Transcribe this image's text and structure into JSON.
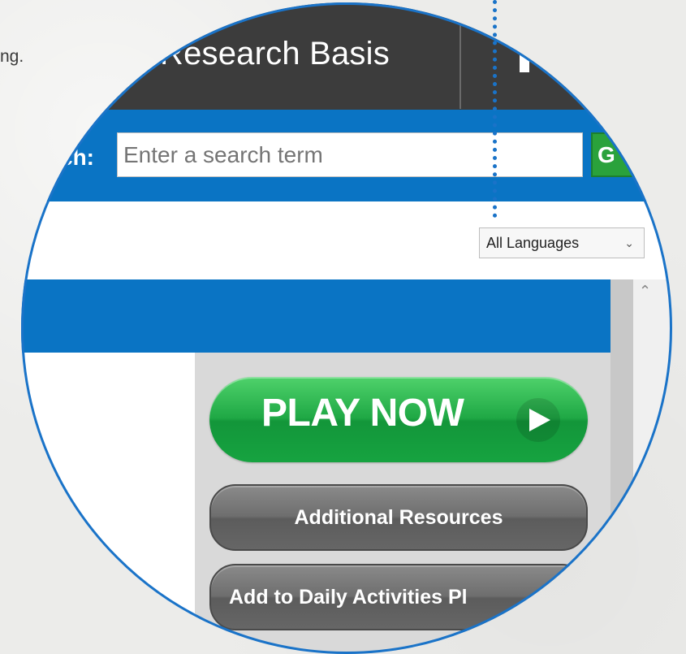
{
  "background": {
    "partial_text": "ng.",
    "fragment_text": "-"
  },
  "header": {
    "tab_title": "Research Basis"
  },
  "search": {
    "label": "ch:",
    "placeholder": "Enter a search term",
    "go_label": "G"
  },
  "language": {
    "selected": "All Languages"
  },
  "actions": {
    "play_now": "PLAY NOW",
    "additional_resources": "Additional Resources",
    "add_daily": "Add to Daily Activities Pl"
  },
  "colors": {
    "header_dark": "#3c3c3c",
    "brand_blue": "#0a74c4",
    "play_green": "#1fa845",
    "button_gray": "#666666",
    "lens_ring": "#1a73c8"
  },
  "icons": {
    "play": "play-triangle-icon",
    "chevron": "chevron-down-icon",
    "scroll_up": "chevron-up-icon"
  }
}
